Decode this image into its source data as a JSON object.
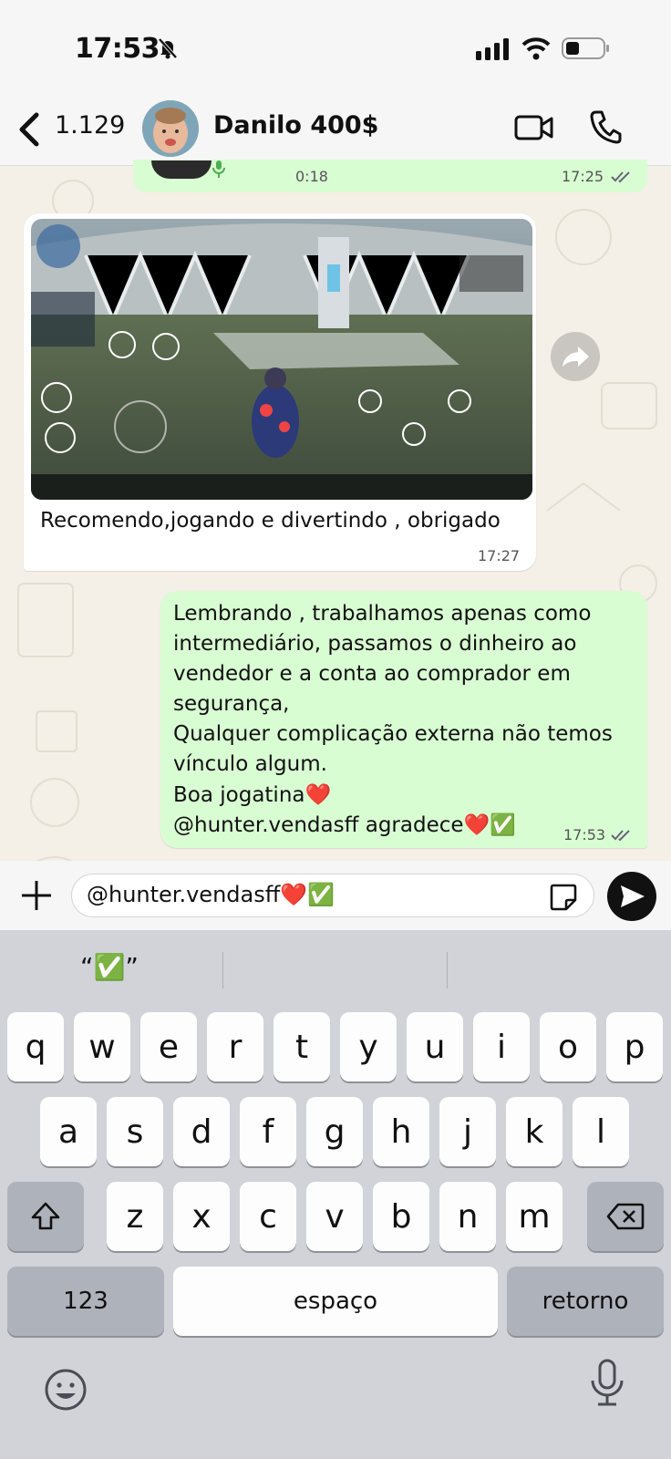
{
  "status": {
    "time": "17:53"
  },
  "header": {
    "back_count": "1.129",
    "contact_name": "Danilo 400$"
  },
  "messages": {
    "voice": {
      "duration": "0:18",
      "time": "17:25"
    },
    "image_message": {
      "caption": "Recomendo,jogando e divertindo , obrigado",
      "time": "17:27"
    },
    "outgoing": {
      "lines": [
        "Lembrando , trabalhamos apenas como",
        "intermediário, passamos o dinheiro ao",
        "vendedor e a conta ao comprador em",
        "segurança,",
        "Qualquer complicação externa não temos",
        "vínculo algum.",
        "Boa jogatina❤️",
        "@hunter.vendasff agradece❤️✅"
      ],
      "time": "17:53"
    }
  },
  "compose": {
    "text": "@hunter.vendasff❤️✅"
  },
  "keyboard": {
    "suggestion": "“✅”",
    "row1": [
      "q",
      "w",
      "e",
      "r",
      "t",
      "y",
      "u",
      "i",
      "o",
      "p"
    ],
    "row2": [
      "a",
      "s",
      "d",
      "f",
      "g",
      "h",
      "j",
      "k",
      "l"
    ],
    "row3": [
      "z",
      "x",
      "c",
      "v",
      "b",
      "n",
      "m"
    ],
    "numbers_label": "123",
    "space_label": "espaço",
    "return_label": "retorno"
  },
  "colors": {
    "outgoing_bubble": "#d9fdd3",
    "incoming_bubble": "#ffffff",
    "keyboard_bg": "#d1d3d9"
  },
  "icons": [
    "bell-slash-icon",
    "signal-icon",
    "wifi-icon",
    "battery-icon",
    "back-chevron-icon",
    "video-call-icon",
    "phone-icon",
    "forward-icon",
    "plus-icon",
    "sticker-icon",
    "send-icon",
    "shift-icon",
    "backspace-icon",
    "emoji-icon",
    "microphone-icon"
  ]
}
